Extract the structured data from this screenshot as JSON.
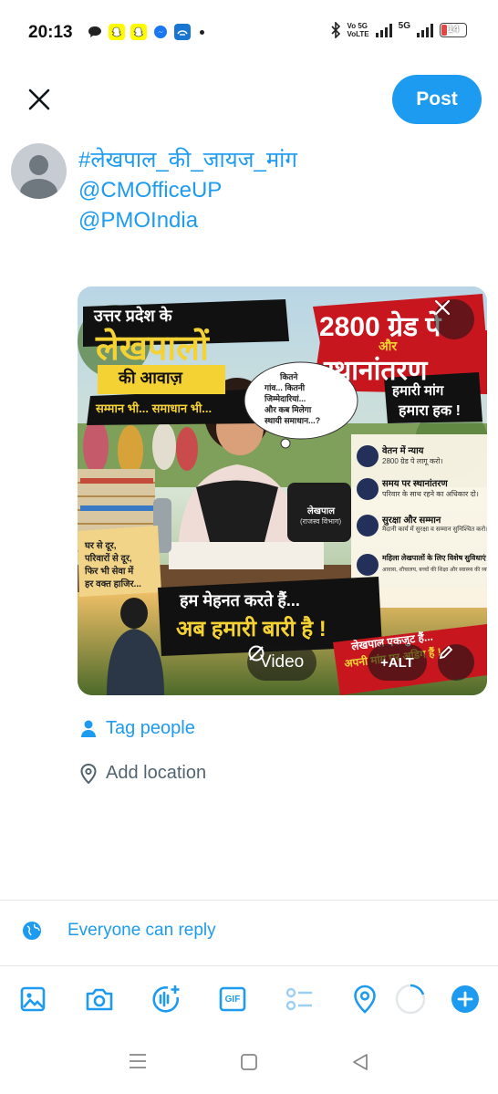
{
  "status_bar": {
    "time": "20:13",
    "net1": "Vo 5G",
    "net1b": "VoLTE",
    "net2": "5G",
    "battery": "14",
    "battery_color": "#e04848"
  },
  "header": {
    "post_label": "Post"
  },
  "composer": {
    "lines": [
      "#लेखपाल_की_जायज_मांग",
      "@CMOfficeUP",
      "@PMOIndia"
    ]
  },
  "media": {
    "video_label": "Video",
    "alt_label": "+ALT",
    "poster": {
      "title1": "उत्तर प्रदेश के",
      "title2": "लेखपालों",
      "title3": "की आवाज़",
      "title4": "सम्मान भी... समाधान भी...",
      "bubble1": "कितने",
      "bubble2": "गांव... कितनी",
      "bubble3": "जिम्मेदारियां...",
      "bubble4": "और कब मिलेगा",
      "bubble5": "स्थायी समाधान...?",
      "grade": "2800 ग्रेड पे",
      "aur": "और",
      "transfer": "स्थानांतरण",
      "demand1": "हमारी मांग",
      "demand2": "हमारा हक !",
      "points": [
        {
          "head": "वेतन में न्याय",
          "sub": "2800 ग्रेड पे लागू करो।"
        },
        {
          "head": "समय पर स्थानांतरण",
          "sub": "परिवार के साथ रहने का अधिकार दो।"
        },
        {
          "head": "सुरक्षा और सम्मान",
          "sub": "मैदानी कार्य में सुरक्षा व सम्मान सुनिश्चित करो।"
        },
        {
          "head": "महिला लेखपालों के लिए विशेष सुविधाएं",
          "sub": "आवास, शौचालय, बच्चों की शिक्षा और स्वास्थ्य की व्यवस्था।"
        }
      ],
      "note1": "घर से दूर,",
      "note2": "परिवारों से दूर,",
      "note3": "फिर भी सेवा में",
      "note4": "हर वक्त हाजिर...",
      "bag": "लेखपाल",
      "bag2": "(राजस्व विभाग)",
      "slogan1": "हम मेहनत करते हैं...",
      "slogan2": "अब हमारी बारी है !",
      "ribbon1": "लेखपाल एकजुट हैं...",
      "ribbon2": "अपनी मांग पर अडिग हैं !"
    }
  },
  "actions": {
    "tag_people": "Tag people",
    "add_location": "Add location",
    "reply_setting": "Everyone can reply"
  },
  "toolbar": {
    "icons": [
      "image-icon",
      "camera-icon",
      "voice-icon",
      "gif-icon",
      "poll-icon",
      "location-icon"
    ],
    "gif_text": "GIF",
    "accent": "#1d9bf0"
  }
}
